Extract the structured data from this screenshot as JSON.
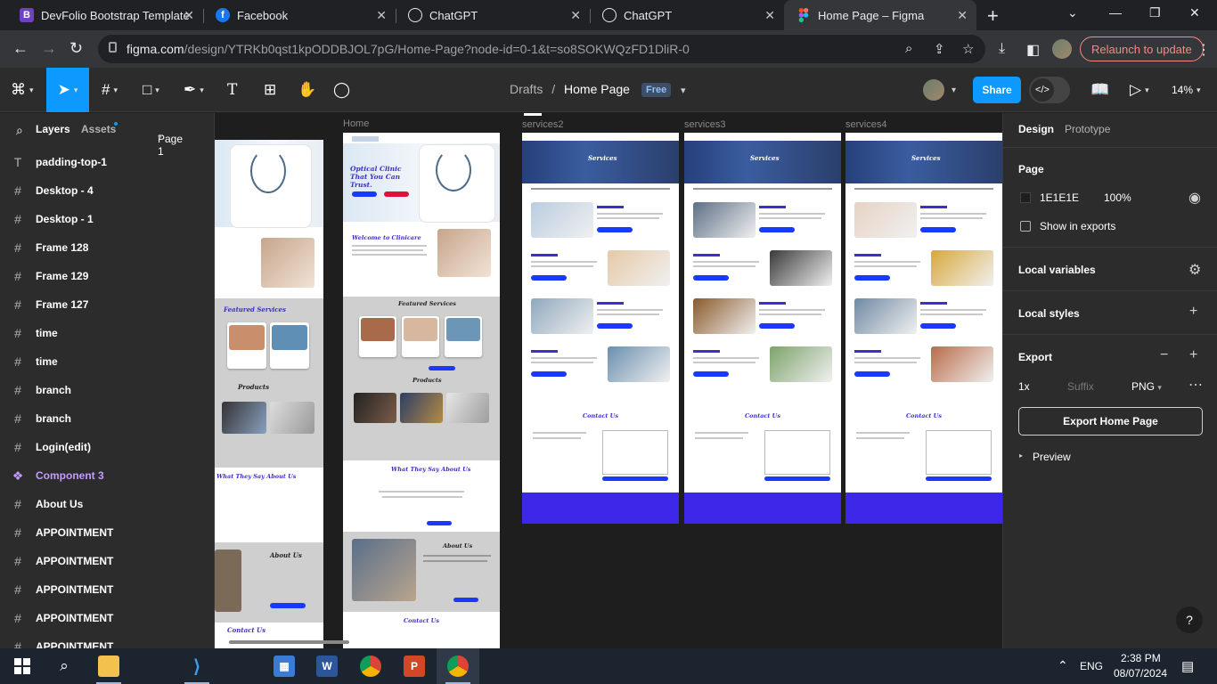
{
  "browser": {
    "tabs": [
      {
        "title": "DevFolio Bootstrap Template",
        "icon": "bootstrap-icon",
        "color": "#6f42c1"
      },
      {
        "title": "Facebook",
        "icon": "facebook-icon",
        "color": "#1877f2"
      },
      {
        "title": "ChatGPT",
        "icon": "chatgpt-icon",
        "color": "#202124"
      },
      {
        "title": "ChatGPT",
        "icon": "chatgpt-icon",
        "color": "#202124"
      },
      {
        "title": "Home Page – Figma",
        "icon": "figma-icon",
        "color": "#202124"
      }
    ],
    "url_host": "figma.com",
    "url_path": "/design/YTRKb0qst1kpODDBJOL7pG/Home-Page?node-id=0-1&t=so8SOKWQzFD1DliR-0",
    "relaunch_label": "Relaunch to update"
  },
  "figma": {
    "breadcrumb_root": "Drafts",
    "breadcrumb_separator": "/",
    "breadcrumb_page": "Home Page",
    "plan_badge": "Free",
    "share_label": "Share",
    "zoom": "14%",
    "left": {
      "tab_layers": "Layers",
      "tab_assets": "Assets",
      "page_selector": "Page 1",
      "layers": [
        {
          "name": "padding-top-1",
          "icon": "T",
          "type": "text"
        },
        {
          "name": "Desktop - 4",
          "icon": "#",
          "type": "frame"
        },
        {
          "name": "Desktop - 1",
          "icon": "#",
          "type": "frame"
        },
        {
          "name": "Frame 128",
          "icon": "#",
          "type": "frame"
        },
        {
          "name": "Frame 129",
          "icon": "#",
          "type": "frame"
        },
        {
          "name": "Frame 127",
          "icon": "#",
          "type": "frame"
        },
        {
          "name": "time",
          "icon": "#",
          "type": "frame"
        },
        {
          "name": "time",
          "icon": "#",
          "type": "frame"
        },
        {
          "name": "branch",
          "icon": "#",
          "type": "frame"
        },
        {
          "name": "branch",
          "icon": "#",
          "type": "frame"
        },
        {
          "name": "Login(edit)",
          "icon": "#",
          "type": "frame"
        },
        {
          "name": "Component 3",
          "icon": "❖",
          "type": "component"
        },
        {
          "name": "About Us",
          "icon": "#",
          "type": "frame"
        },
        {
          "name": "APPOINTMENT",
          "icon": "#",
          "type": "frame"
        },
        {
          "name": "APPOINTMENT",
          "icon": "#",
          "type": "frame"
        },
        {
          "name": "APPOINTMENT",
          "icon": "#",
          "type": "frame"
        },
        {
          "name": "APPOINTMENT",
          "icon": "#",
          "type": "frame"
        },
        {
          "name": "APPOINTMENT",
          "icon": "#",
          "type": "frame"
        }
      ]
    },
    "canvas": {
      "frame_labels": [
        "Home",
        "services2",
        "services3",
        "services4"
      ],
      "home_hero_title": "Optical Clinic That You Can Trust.",
      "home_welcome": "Welcome to Clinicare",
      "featured_services": "Featured Services",
      "products": "Products",
      "testimonials": "What They Say About Us",
      "about": "About Us",
      "contact": "Contact Us",
      "services_banner": "Services"
    },
    "right": {
      "tab_design": "Design",
      "tab_prototype": "Prototype",
      "page_heading": "Page",
      "page_color": "1E1E1E",
      "page_opacity": "100%",
      "show_in_exports": "Show in exports",
      "local_variables": "Local variables",
      "local_styles": "Local styles",
      "export_heading": "Export",
      "export_scale": "1x",
      "export_suffix_placeholder": "Suffix",
      "export_format": "PNG",
      "export_button": "Export Home Page",
      "preview": "Preview",
      "help": "?"
    }
  },
  "taskbar": {
    "language": "ENG",
    "time": "2:38 PM",
    "date": "08/07/2024"
  }
}
